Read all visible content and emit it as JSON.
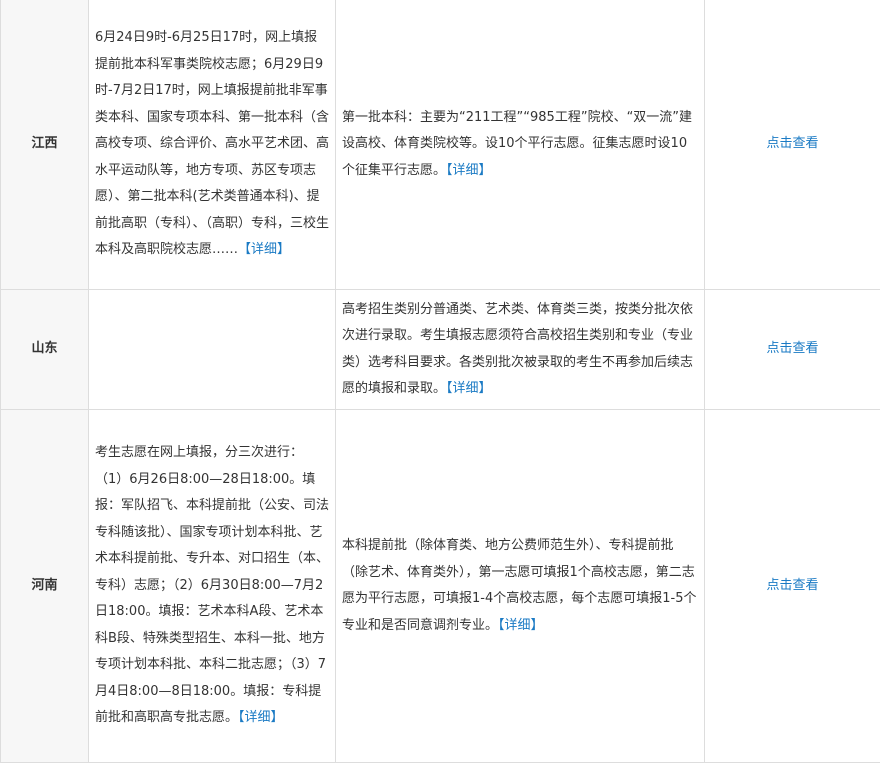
{
  "rows": [
    {
      "province": "江西",
      "col2": "6月24日9时-6月25日17时，网上填报提前批本科军事类院校志愿；6月29日9时-7月2日17时，网上填报提前批非军事类本科、国家专项本科、第一批本科（含高校专项、综合评价、高水平艺术团、高水平运动队等，地方专项、苏区专项志愿）、第二批本科(艺术类普通本科)、提前批高职（专科）、（高职）专科，三校生本科及高职院校志愿……",
      "col2_more": "【详细】",
      "col3": "第一批本科：主要为“211工程”“985工程”院校、“双一流”建设高校、体育类院校等。设10个平行志愿。征集志愿时设10个征集平行志愿。",
      "col3_more": "【详细】",
      "link": "点击查看"
    },
    {
      "province": "山东",
      "col2": "",
      "col2_more": "",
      "col3": "高考招生类别分普通类、艺术类、体育类三类，按类分批次依次进行录取。考生填报志愿须符合高校招生类别和专业（专业类）选考科目要求。各类别批次被录取的考生不再参加后续志愿的填报和录取。",
      "col3_more": "【详细】",
      "link": "点击查看"
    },
    {
      "province": "河南",
      "col2_lines": [
        "考生志愿在网上填报，分三次进行：",
        "（1）6月26日8:00—28日18:00。填报：军队招飞、本科提前批（公安、司法专科随该批）、国家专项计划本科批、艺术本科提前批、专升本、对口招生（本、专科）志愿；（2）6月30日8:00—7月2日18:00。填报：艺术本科A段、艺术本科B段、特殊类型招生、本科一批、地方专项计划本科批、本科二批志愿；（3）7月4日8:00—8日18:00。填报：专科提前批和高职高专批志愿。"
      ],
      "col2_more": "【详细】",
      "col3": "本科提前批（除体育类、地方公费师范生外）、专科提前批（除艺术、体育类外），第一志愿可填报1个高校志愿，第二志愿为平行志愿，可填报1-4个高校志愿，每个志愿可填报1-5个专业和是否同意调剂专业。",
      "col3_more": "【详细】",
      "link": "点击查看"
    }
  ],
  "colors": {
    "link": "#1a7ac4",
    "border": "#dddddd",
    "province_bg": "#f7f7f7",
    "text": "#333333"
  }
}
